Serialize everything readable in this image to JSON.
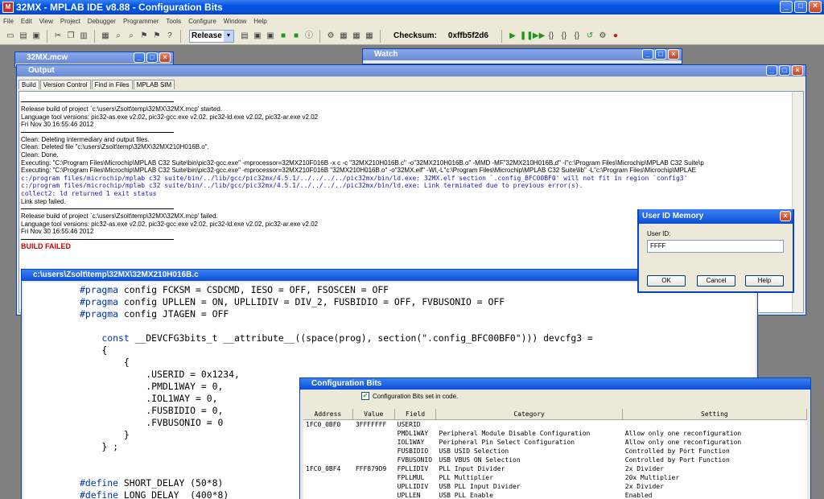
{
  "app": {
    "title": "32MX - MPLAB IDE v8.88 - Configuration Bits"
  },
  "menu": [
    "File",
    "Edit",
    "View",
    "Project",
    "Debugger",
    "Programmer",
    "Tools",
    "Configure",
    "Window",
    "Help"
  ],
  "toolbar": {
    "build_config": "Release",
    "checksum_label": "Checksum:",
    "checksum_value": "0xffb5f2d6"
  },
  "windows": {
    "mcw_title": "32MX.mcw",
    "watch_title": "Watch",
    "output_title": "Output",
    "editor_title": "c:\\users\\Zsolt\\temp\\32MX\\32MX210H016B.c",
    "config_title": "Configuration Bits"
  },
  "output": {
    "tabs": [
      "Build",
      "Version Control",
      "Find in Files",
      "MPLAB SIM"
    ],
    "lines": [
      {
        "t": "hr",
        "text": ""
      },
      {
        "t": "text",
        "text": "Release build of project `c:\\users\\Zsolt\\temp\\32MX\\32MX.mcp' started."
      },
      {
        "t": "text",
        "text": "Language tool versions: pic32-as.exe v2.02, pic32-gcc.exe v2.02, pic32-ld.exe v2.02, pic32-ar.exe v2.02"
      },
      {
        "t": "text",
        "text": "Fri Nov 30 16:55:46 2012"
      },
      {
        "t": "hr",
        "text": ""
      },
      {
        "t": "text",
        "text": "Clean: Deleting intermediary and output files."
      },
      {
        "t": "text",
        "text": "Clean: Deleted file \"c:\\users\\Zsolt\\temp\\32MX\\32MX210H016B.o\"."
      },
      {
        "t": "text",
        "text": "Clean: Done."
      },
      {
        "t": "text",
        "text": "Executing: \"C:\\Program Files\\Microchip\\MPLAB C32 Suite\\bin\\pic32-gcc.exe\" -mprocessor=32MX210F016B -x c -c \"32MX210H016B.c\" -o\"32MX210H016B.o\" -MMD -MF\"32MX210H016B.d\" -I\"c:\\Program Files\\Microchip\\MPLAB C32 Suite\\p"
      },
      {
        "t": "text",
        "text": "Executing: \"C:\\Program Files\\Microchip\\MPLAB C32 Suite\\bin\\pic32-gcc.exe\" -mprocessor=32MX210F016B \"32MX210H016B.o\" -o\"32MX.elf\" -Wl,-L\"c:\\Program Files\\Microchip\\MPLAB C32 Suite\\lib\" -L\"c:\\Program Files\\Microchip\\MPLAE"
      },
      {
        "t": "mono",
        "text": "c:/program files/microchip/mplab c32 suite/bin/../lib/gcc/pic32mx/4.5.1/../../../../pic32mx/bin/ld.exe: 32MX.elf section `.config_BFC00BF0' will not fit in region `config3'"
      },
      {
        "t": "mono",
        "text": "c:/program files/microchip/mplab c32 suite/bin/../lib/gcc/pic32mx/4.5.1/../../../../pic32mx/bin/ld.exe: Link terminated due to previous error(s)."
      },
      {
        "t": "mono",
        "text": "collect2: ld returned 1 exit status"
      },
      {
        "t": "text",
        "text": "Link step failed."
      },
      {
        "t": "hr",
        "text": ""
      },
      {
        "t": "text",
        "text": "Release build of project `c:\\users\\Zsolt\\temp\\32MX\\32MX.mcp' failed."
      },
      {
        "t": "text",
        "text": "Language tool versions: pic32-as.exe v2.02, pic32-gcc.exe v2.02, pic32-ld.exe v2.02, pic32-ar.exe v2.02"
      },
      {
        "t": "text",
        "text": "Fri Nov 30 16:55:46 2012"
      },
      {
        "t": "hr",
        "text": ""
      },
      {
        "t": "fail",
        "text": "BUILD FAILED"
      }
    ]
  },
  "editor": {
    "lines": [
      {
        "kw": "#pragma",
        "rest": " config FCKSM = CSDCMD, IESO = OFF, FSOSCEN = OFF"
      },
      {
        "kw": "#pragma",
        "rest": " config UPLLEN = ON, UPLLIDIV = DIV_2, FUSBIDIO = OFF, FVBUSONIO = OFF"
      },
      {
        "kw": "#pragma",
        "rest": " config JTAGEN = OFF"
      },
      {
        "kw": "",
        "rest": ""
      },
      {
        "kw": "    const",
        "rest": " __DEVCFG3bits_t __attribute__((space(prog), section(\".config_BFC00BF0\"))) devcfg3 ="
      },
      {
        "kw": "",
        "rest": "    {"
      },
      {
        "kw": "",
        "rest": "        {"
      },
      {
        "kw": "",
        "rest": "            .USERID = 0x1234,"
      },
      {
        "kw": "",
        "rest": "            .PMDL1WAY = 0,"
      },
      {
        "kw": "",
        "rest": "            .IOL1WAY = 0,"
      },
      {
        "kw": "",
        "rest": "            .FUSBIDIO = 0,"
      },
      {
        "kw": "",
        "rest": "            .FVBUSONIO = 0"
      },
      {
        "kw": "",
        "rest": "        }"
      },
      {
        "kw": "",
        "rest": "    } ;"
      },
      {
        "kw": "",
        "rest": ""
      },
      {
        "kw": "",
        "rest": ""
      },
      {
        "kw": "#define",
        "rest": " SHORT_DELAY (50*8)"
      },
      {
        "kw": "#define",
        "rest": " LONG_DELAY  (400*8)"
      }
    ]
  },
  "dialog": {
    "title": "User ID Memory",
    "label": "User ID:",
    "value": "FFFF",
    "ok": "OK",
    "cancel": "Cancel",
    "help": "Help"
  },
  "config": {
    "checkbox_label": "Configuration Bits set in code.",
    "headers": [
      "Address",
      "Value",
      "Field",
      "Category",
      "Setting"
    ],
    "rows": [
      [
        "1FC0_0BF0",
        "3FFFFFFF",
        "USERID",
        "",
        ""
      ],
      [
        "",
        "",
        "PMDL1WAY",
        "Peripheral Module Disable Configuration",
        "Allow only one reconfiguration"
      ],
      [
        "",
        "",
        "IOL1WAY",
        "Peripheral Pin Select Configuration",
        "Allow only one reconfiguration"
      ],
      [
        "",
        "",
        "FUSBIDIO",
        "USB USID Selection",
        "Controlled by Port Function"
      ],
      [
        "",
        "",
        "FVBUSONIO",
        "USB VBUS ON Selection",
        "Controlled by Port Function"
      ],
      [
        "1FC0_0BF4",
        "FFF879D9",
        "FPLLIDIV",
        "PLL Input Divider",
        "2x Divider"
      ],
      [
        "",
        "",
        "FPLLMUL",
        "PLL Multiplier",
        "20x Multiplier"
      ],
      [
        "",
        "",
        "UPLLIDIV",
        "USB PLL Input Divider",
        "2x Divider"
      ],
      [
        "",
        "",
        "UPLLEN",
        "USB PLL Enable",
        "Enabled"
      ]
    ]
  }
}
